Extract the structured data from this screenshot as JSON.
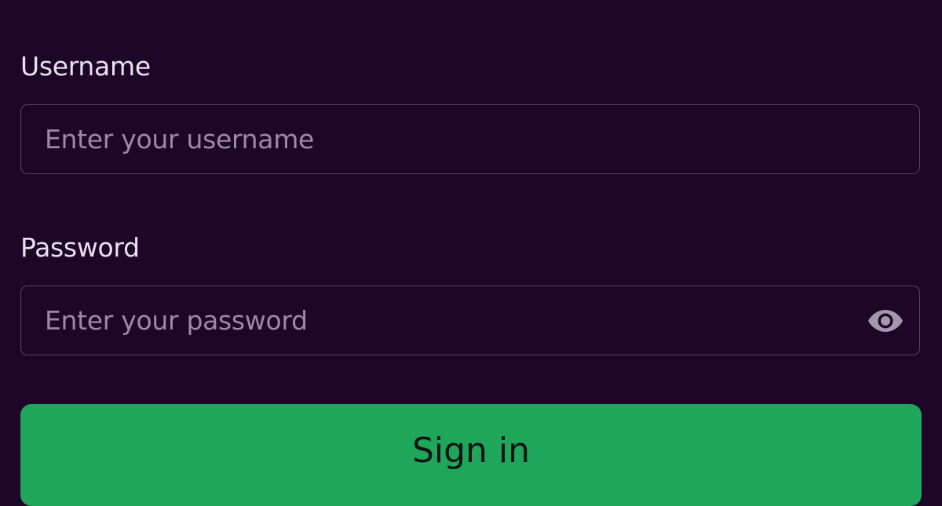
{
  "form": {
    "username": {
      "label": "Username",
      "placeholder": "Enter your username",
      "value": ""
    },
    "password": {
      "label": "Password",
      "placeholder": "Enter your password",
      "value": "",
      "toggle_icon": "eye-icon"
    },
    "submit_label": "Sign in"
  },
  "colors": {
    "background": "#1d0628",
    "field_border": "#5a4665",
    "placeholder": "#9b8aa5",
    "label_text": "#e9e1ee",
    "button_bg": "#1ea65a",
    "button_text": "#0f1412"
  }
}
